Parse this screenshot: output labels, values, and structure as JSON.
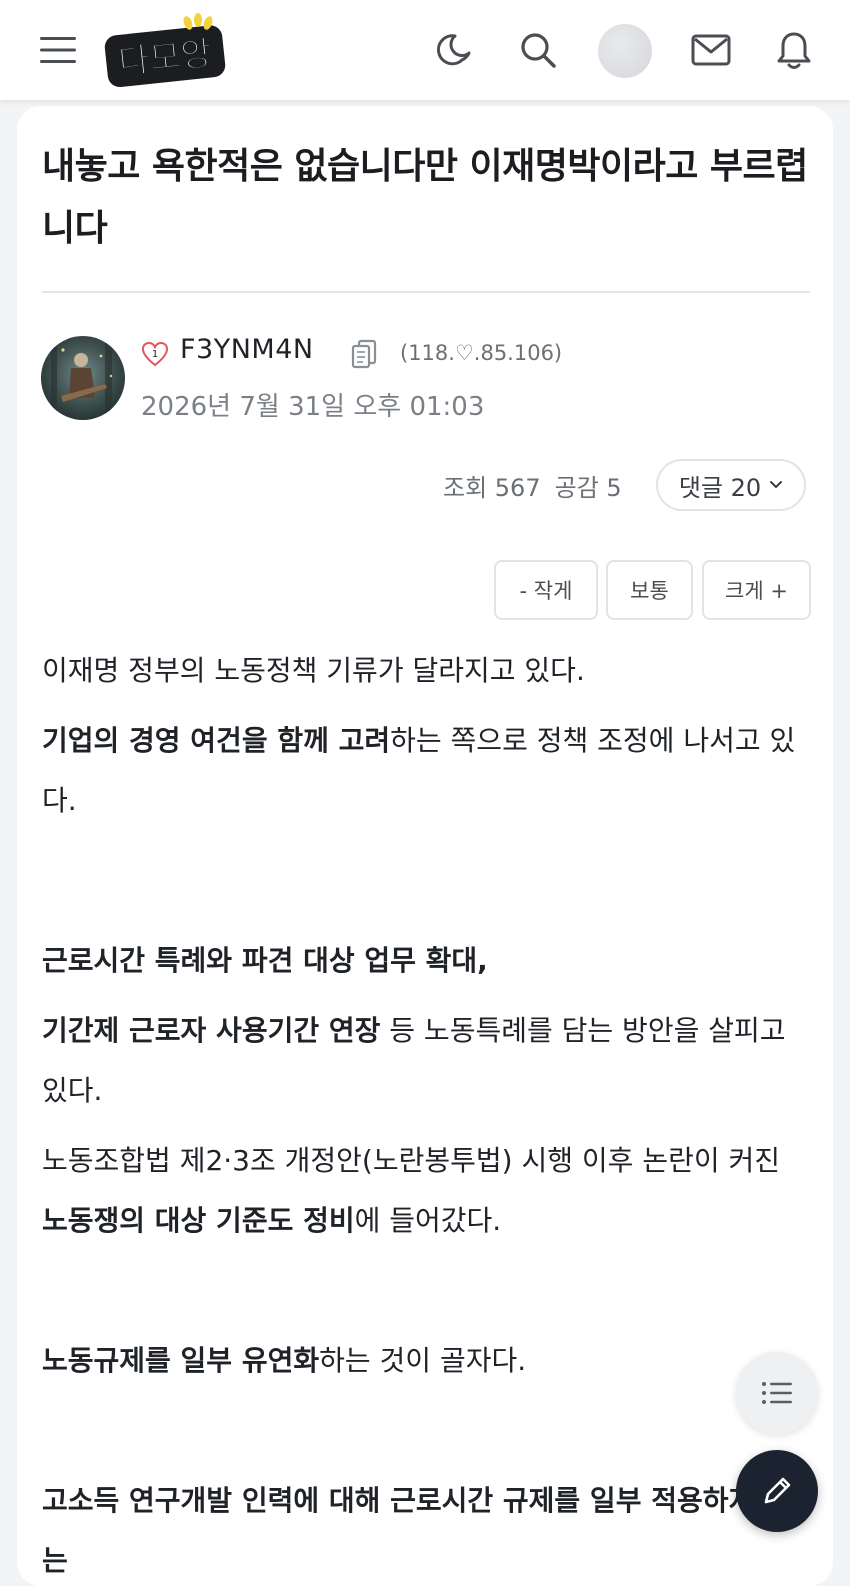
{
  "header": {
    "logo_text": "다모앙",
    "icons": [
      "menu-icon",
      "moon-icon",
      "search-icon",
      "avatar",
      "mail-icon",
      "bell-icon"
    ]
  },
  "post": {
    "title": "내놓고 욕한적은 없습니다만 이재명박이라고 부르렵니다",
    "author": {
      "level": "1",
      "name": "F3YNM4N",
      "ip": "(118.♡.85.106)",
      "date": "2026년 7월 31일 오후 01:03"
    },
    "stats": {
      "views": "조회 567",
      "likes": "공감 5",
      "comments": "댓글 20"
    },
    "font_size_controls": {
      "smaller": "- 작게",
      "normal": "보통",
      "larger": "크게 +"
    },
    "body": {
      "p1": "이재명 정부의 노동정책 기류가 달라지고 있다.",
      "p2_bold": "기업의 경영 여건을 함께 고려",
      "p2_rest": "하는 쪽으로 정책 조정에 나서고 있다.",
      "p3": "근로시간 특례와 파견 대상 업무 확대,",
      "p4_bold": "기간제 근로자 사용기간 연장",
      "p4_rest": " 등 노동특례를 담는 방안을 살피고 있다.",
      "p5_pre": "노동조합법 제2·3조 개정안(노란봉투법) 시행 이후 논란이 커진 ",
      "p5_bold": "노동쟁의 대상 기준도 정비",
      "p5_rest": "에 들어갔다.",
      "p6_bold": "노동규제를 일부 유연화",
      "p6_rest": "하는 것이 골자다.",
      "p7": "고소득 연구개발 인력에 대해 근로시간 규제를 일부 적용하지 않는"
    }
  },
  "colors": {
    "accent_dark": "#1c2330",
    "badge_red": "#e0565b",
    "text_primary": "#1f2328",
    "text_muted": "#7b8086"
  }
}
